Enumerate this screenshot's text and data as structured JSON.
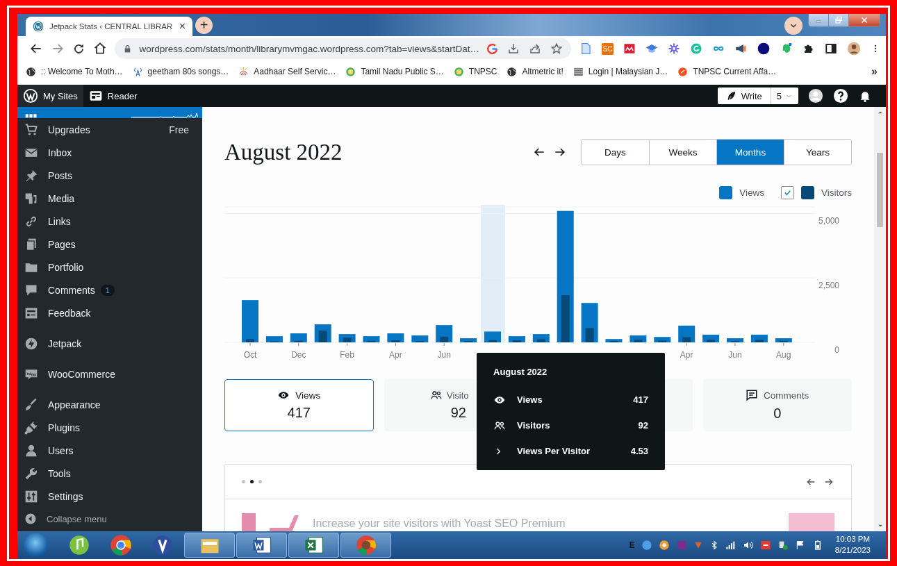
{
  "browser": {
    "tab": {
      "title": "Jetpack Stats ‹ CENTRAL LIBRAR",
      "close": "×"
    },
    "new_tab": "+",
    "address": "wordpress.com/stats/month/librarymvmgac.wordpress.com?tab=views&startDat…",
    "extension_badge": "SC",
    "bookmarks": [
      ":: Welcome To Moth…",
      "geetham 80s songs…",
      "Aadhaar Self Servic…",
      "Tamil Nadu Public S…",
      "TNPSC",
      "Altmetric it!",
      "Login | Malaysian J…",
      "TNPSC Current Affa…"
    ],
    "bookmarks_more": "»"
  },
  "admin_bar": {
    "my_sites": "My Sites",
    "reader": "Reader",
    "write": "Write",
    "drafts": "5"
  },
  "sidebar": {
    "sections": [
      [
        {
          "label": "Upgrades",
          "badge": "Free"
        },
        {
          "label": "Inbox"
        },
        {
          "label": "Posts"
        },
        {
          "label": "Media"
        },
        {
          "label": "Links"
        },
        {
          "label": "Pages"
        },
        {
          "label": "Portfolio"
        },
        {
          "label": "Comments",
          "count": "1"
        },
        {
          "label": "Feedback"
        }
      ],
      [
        {
          "label": "Jetpack"
        }
      ],
      [
        {
          "label": "WooCommerce"
        }
      ],
      [
        {
          "label": "Appearance"
        },
        {
          "label": "Plugins"
        },
        {
          "label": "Users"
        },
        {
          "label": "Tools"
        },
        {
          "label": "Settings"
        }
      ]
    ],
    "collapse": "Collapse menu"
  },
  "stats": {
    "title": "August 2022",
    "periods": [
      {
        "label": "Days",
        "selected": false
      },
      {
        "label": "Weeks",
        "selected": false
      },
      {
        "label": "Months",
        "selected": true
      },
      {
        "label": "Years",
        "selected": false
      }
    ],
    "legend": {
      "visitors_checked": true
    },
    "chart_data": {
      "type": "bar",
      "categories": [
        "Oct",
        null,
        "Dec",
        null,
        "Feb",
        null,
        "Apr",
        null,
        "Jun",
        null,
        null,
        null,
        null,
        null,
        null,
        null,
        null,
        null,
        "Apr",
        null,
        "Jun",
        null,
        "Aug"
      ],
      "series": [
        {
          "name": "Views",
          "color": "#0675c4",
          "values": [
            1640,
            240,
            350,
            700,
            320,
            240,
            350,
            270,
            670,
            160,
            420,
            240,
            320,
            5100,
            1530,
            130,
            270,
            210,
            650,
            300,
            160,
            300,
            160
          ]
        },
        {
          "name": "Visitors",
          "color": "#064a7a",
          "values": [
            130,
            40,
            60,
            460,
            180,
            60,
            80,
            50,
            220,
            50,
            90,
            80,
            120,
            1830,
            560,
            60,
            100,
            70,
            200,
            100,
            50,
            100,
            60
          ]
        }
      ],
      "ylim": [
        0,
        5200
      ],
      "yticks": [
        0,
        {
          "value": 2500,
          "label": "2,500"
        },
        {
          "value": 5000,
          "label": "5,000"
        }
      ]
    },
    "tooltip": {
      "title": "August 2022",
      "rows": [
        {
          "kind": "eye",
          "label": "Views",
          "value": "417"
        },
        {
          "kind": "people",
          "label": "Visitors",
          "value": "92"
        },
        {
          "kind": "chevron",
          "label": "Views Per Visitor",
          "value": "4.53"
        }
      ]
    },
    "cards": [
      {
        "kind": "eye",
        "label": "Views",
        "value": "417",
        "selected": true
      },
      {
        "kind": "people",
        "label": "Visito",
        "value": "92",
        "selected": false
      },
      {
        "kind": "covered",
        "selected": false
      },
      {
        "kind": "comment",
        "label": "Comments",
        "value": "0",
        "selected": false
      }
    ]
  },
  "promo": {
    "dots": [
      {
        "selected": false
      },
      {
        "selected": true
      },
      {
        "selected": false
      }
    ],
    "text": "Increase your site visitors with Yoast SEO Premium"
  },
  "taskbar": {
    "tray_letter": "E",
    "time": "10:03 PM",
    "date": "8/21/2023"
  }
}
